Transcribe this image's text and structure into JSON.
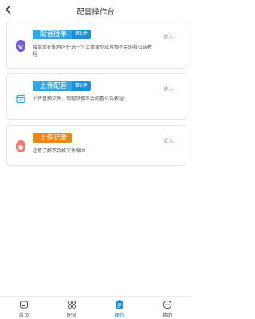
{
  "header": {
    "back_icon": "back-icon",
    "title": "配音操作台"
  },
  "cards": [
    {
      "icon": "voice-circle-icon",
      "title": "配音接单",
      "step": "第1步",
      "desc": "接单后在配音区任选一个文本录制成音频不会的看公告教程",
      "enter": "进入"
    },
    {
      "icon": "upload-box-icon",
      "title": "上传配音",
      "step": "第2步",
      "desc": "上传音频文件，到期领佣不会的看公告教程",
      "enter": "进入"
    },
    {
      "icon": "record-dot-icon",
      "title": "上传记录",
      "desc": "注意了解不合格文件原因",
      "enter": "进入"
    }
  ],
  "tabs": [
    {
      "label": "首页",
      "icon": "home-icon"
    },
    {
      "label": "配音",
      "icon": "grid-icon"
    },
    {
      "label": "操作",
      "icon": "clipboard-icon",
      "active": true
    },
    {
      "label": "我的",
      "icon": "chat-icon"
    }
  ],
  "colors": {
    "accent_blue": "#2ea6e8",
    "accent_orange": "#e68a1f",
    "purple": "#7a5ad6",
    "coral": "#f07e6e"
  }
}
